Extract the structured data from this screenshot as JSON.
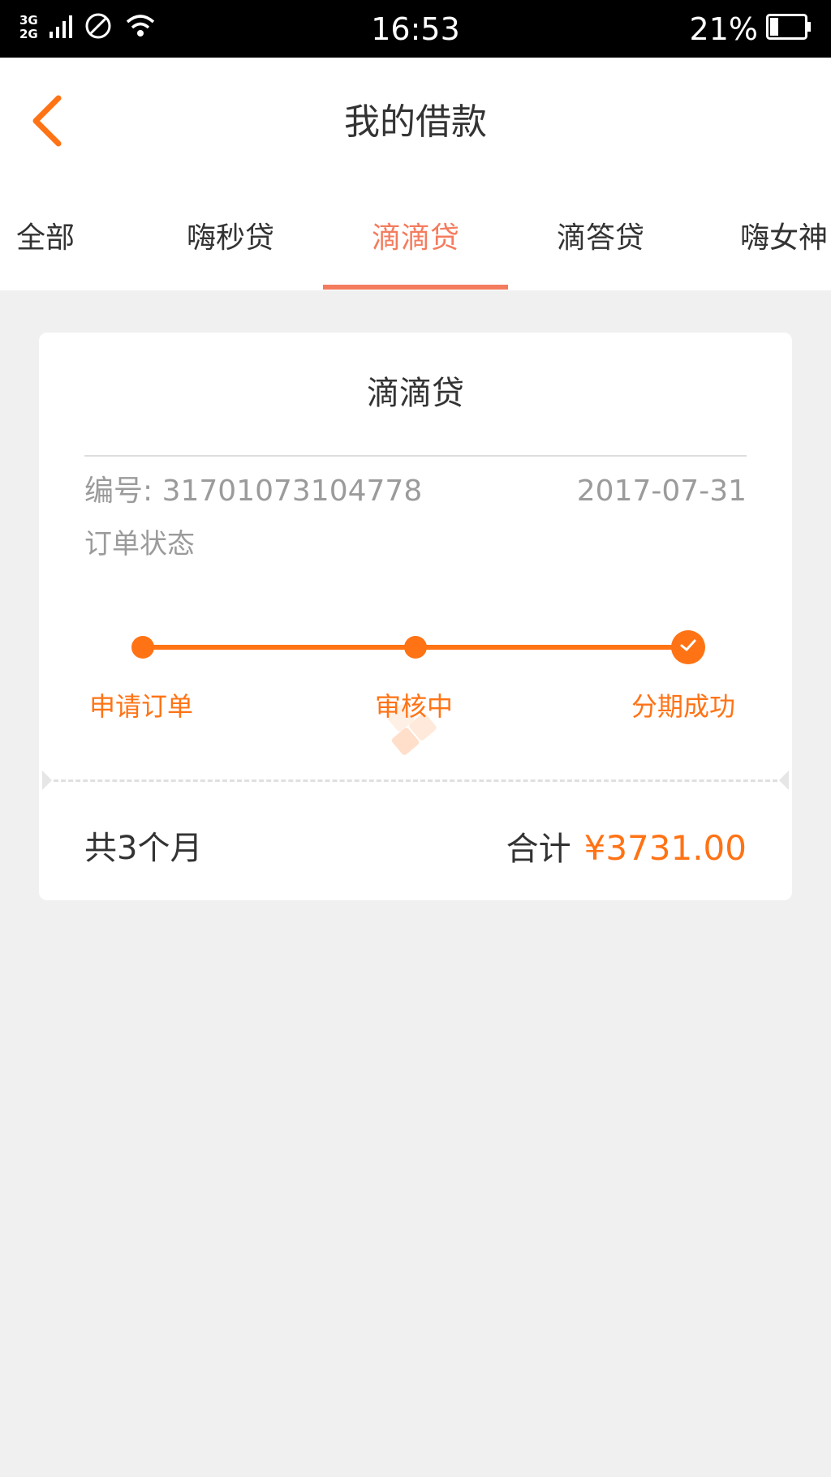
{
  "status_bar": {
    "network_top": "3G",
    "network_bottom": "2G",
    "time": "16:53",
    "battery": "21%",
    "icons": [
      "signal-icon",
      "no-disturb-icon",
      "wifi-icon",
      "battery-icon"
    ]
  },
  "header": {
    "title": "我的借款",
    "back_icon": "chevron-left-icon"
  },
  "tabs": [
    {
      "label": "全部",
      "active": false
    },
    {
      "label": "嗨秒贷",
      "active": false
    },
    {
      "label": "滴滴贷",
      "active": true
    },
    {
      "label": "滴答贷",
      "active": false
    },
    {
      "label": "嗨女神",
      "active": false
    }
  ],
  "card": {
    "title": "滴滴贷",
    "order_no": "编号: 31701073104778",
    "date": "2017-07-31",
    "status_label": "订单状态",
    "steps": [
      {
        "label": "申请订单"
      },
      {
        "label": "审核中"
      },
      {
        "label": "分期成功"
      }
    ],
    "months": "共3个月",
    "total_label": "合计",
    "total_amount": "¥3731.00"
  },
  "colors": {
    "accent": "#ff7315",
    "tab_active": "#f47c5e",
    "text_primary": "#333333",
    "text_secondary": "#9b9b9b",
    "background": "#f0f0f0"
  }
}
